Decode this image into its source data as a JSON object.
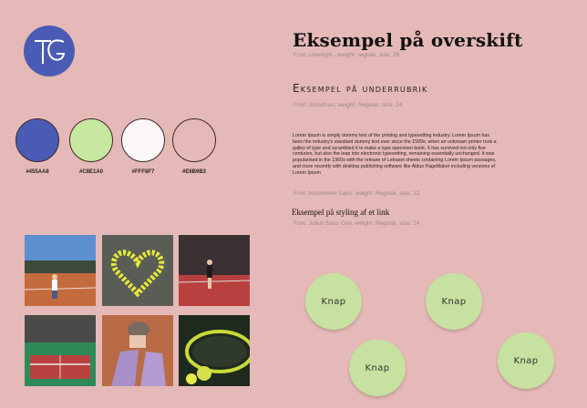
{
  "logo": {
    "text": "TG",
    "color": "#4a5bb5"
  },
  "palette": [
    {
      "hex": "#4A5BB5",
      "label": "#455AA8"
    },
    {
      "hex": "#C7E8A0",
      "label": "#C8E1A0"
    },
    {
      "hex": "#FBF6F7",
      "label": "#FFF8F7"
    },
    {
      "hex": "#E5B9B7",
      "label": "#E6B9B3"
    }
  ],
  "typography": {
    "heading": "Eksempel på overskift",
    "heading_meta": "Font: Limelight , weight: regular, size: 26",
    "subheading": "Eksempel på underrubrik",
    "subheading_meta": "Font: Jomolhari, weight: Regular, size: 24",
    "body": "Lorem Ipsum is simply dummy text of the printing and typesetting industry. Lorem Ipsum has been the industry's standard dummy text ever since the 1500s, when an unknown printer took a galley of type and scrambled it to make a type specimen book. It has survived not only five centuries, but also the leap into electronic typesetting, remaining essentially unchanged. It was popularised in the 1960s with the release of Letraset sheets containing Lorem Ipsum passages, and more recently with desktop publishing software like Aldus PageMaker including versions of Lorem Ipsum",
    "body_meta": "Font: Instrument Sans, weight: Regular, size: 12",
    "link": "Eksempel på styling af et link",
    "link_meta": "Font: Julius Sans One, weight: Regular, size: 24"
  },
  "photos": [
    "tennis-player-outdoor",
    "heart-of-tennis-balls",
    "indoor-player-serving",
    "indoor-tennis-court",
    "shoes-on-clay",
    "racket-and-balls"
  ],
  "buttons": {
    "label": "Knap",
    "color": "#c7e2a0"
  }
}
